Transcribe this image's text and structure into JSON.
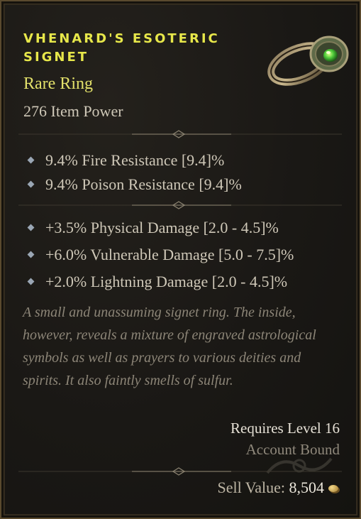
{
  "item": {
    "name": "VHENARD'S ESOTERIC SIGNET",
    "rarity": "Rare Ring",
    "power": "276 Item Power",
    "icon": "ring-icon"
  },
  "base_stats": [
    {
      "text": "9.4% Fire Resistance [9.4]%"
    },
    {
      "text": "9.4% Poison Resistance [9.4]%"
    }
  ],
  "affixes": [
    {
      "text": "+3.5% Physical Damage [2.0 - 4.5]%"
    },
    {
      "text": "+6.0% Vulnerable Damage [5.0 - 7.5]%"
    },
    {
      "text": "+2.0% Lightning Damage [2.0 - 4.5]%"
    }
  ],
  "flavor": "A small and unassuming signet ring. The inside, however, reveals a mixture of engraved astrological symbols as well as prayers to various deities and spirits. It also faintly smells of sulfur.",
  "requirements": {
    "level": "Requires Level 16",
    "binding": "Account Bound"
  },
  "sell": {
    "label": "Sell Value:",
    "value": "8,504",
    "icon": "gold-coin-icon"
  },
  "colors": {
    "name": "#e7e74a",
    "rarity": "#e2e06a",
    "text": "#cfc8b8",
    "flavor": "#8c8577",
    "border": "#5a4a2e"
  }
}
